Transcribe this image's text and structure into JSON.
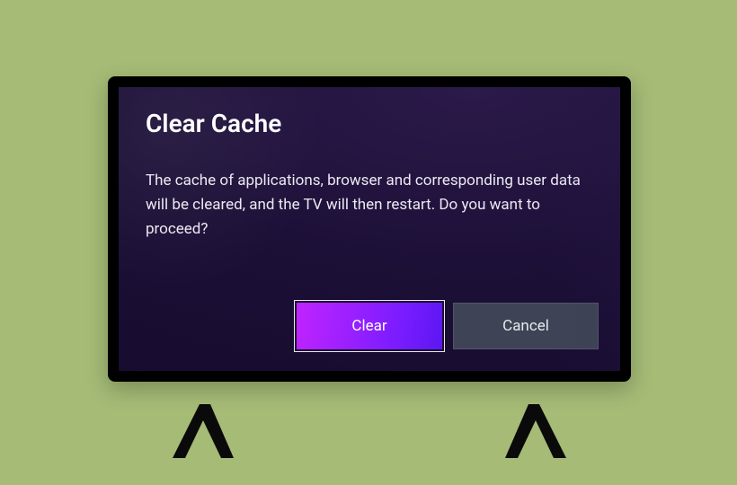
{
  "dialog": {
    "title": "Clear Cache",
    "body": "The cache of applications, browser and corresponding user data will be cleared, and the TV will then restart. Do you want to proceed?",
    "buttons": {
      "clear": "Clear",
      "cancel": "Cancel"
    }
  }
}
